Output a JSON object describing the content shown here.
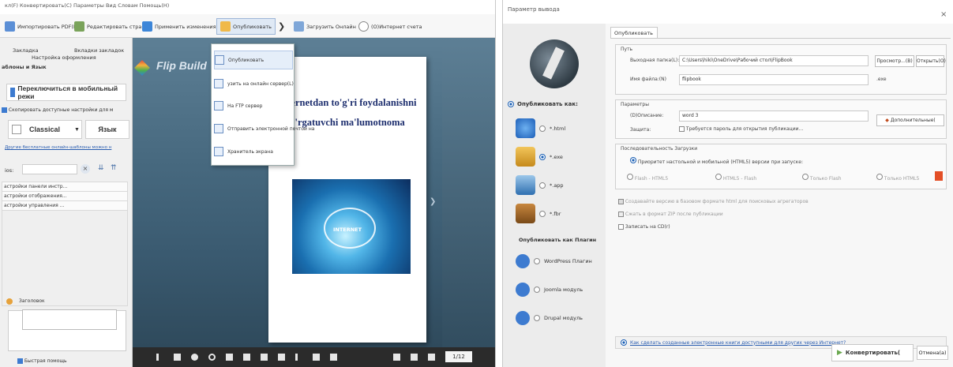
{
  "left_app": {
    "menubar": "кл(F)   Конвертировать(C)   Параметры   Вид   Словам   Помощь(H)",
    "toolbar": {
      "import_pdf": "Импортировать PDF(I)",
      "edit_pages": "Редактировать страниц",
      "apply_changes": "Применить изменения",
      "publish": "Опубликовать",
      "upload_online": "Загрузить Онлайн",
      "internet_account": "(О)Интернет счета"
    },
    "panel": {
      "tab_templates": "Закладка",
      "tab_bookmarks": "Вкладки закладок",
      "design_settings": "Настройка оформления",
      "templates_language": "аблоны и Язык",
      "mobile_switch": "Переключиться в мобильный режи",
      "copy_settings": "Скопировать доступные настройки для м",
      "theme_select": "Classical",
      "language_button": "Язык",
      "free_templates_link": "Другие бесплатные онлайн-шаблоны можно н",
      "search_label": "ios:",
      "settings_rows": [
        "астройки панели инстр...",
        "астройки отображения...",
        "астройки управления ..."
      ],
      "title_label": "Заголовок",
      "quick_help": "Быстрая помощь"
    },
    "brand": "Flip Build",
    "book": {
      "title": "Internetdan to'g'ri foydalanishni o'rgatuvchi ma'lumotnoma",
      "page_counter": "1/12",
      "image_text": "INTERNET"
    },
    "dropdown": [
      "Опубликовать",
      "узить на онлайн сервер(L)",
      "На FTP сервер",
      "Отправить электронной почтой на",
      "Хранитель экрана"
    ]
  },
  "dialog": {
    "title": "Параметр вывода",
    "close": "×",
    "tab": "Опубликовать",
    "publish_as": "Опубликовать как:",
    "formats": [
      "*.html",
      "*.exe",
      "*.app",
      "*.fbr"
    ],
    "publish_as_plugin": "Опубликовать как Плагин",
    "plugins": [
      "WordPress Плагин",
      "Joomla модуль",
      "Drupal модуль"
    ],
    "path_group": "Путь",
    "output_folder_label": "Выходная папка(L):",
    "output_folder_value": "C:\\Users\\hiki\\OneDrive\\Рабочий стол\\FlipBook",
    "browse": "Просмотр...(B)",
    "open": "Открыть(O)",
    "filename_label": "Имя файла:(N)",
    "filename_value": "flipbook",
    "ext": ".exe",
    "params_group": "Параметры",
    "description_label": "(D)Описание:",
    "description_value": "word 3",
    "protect_label": "Защита:",
    "protect_check": "Требуется пароль для открытия публикации...",
    "advanced": "Дополнительные(",
    "load_order_group": "Последовательность Загрузки",
    "priority_text": "Приоритет настольной и мобильной (HTML5) версии при запуске:",
    "load_options": [
      "Flash - HTML5",
      "HTML5 - Flash",
      "Только Flash",
      "Только HTML5"
    ],
    "create_base": "Создавайте версию в базовом формате html для поисковых агрегаторов",
    "zip": "Сжать в формат ZIP после публикации",
    "burn_cd": "Записать на CD(r)",
    "help_link": "Как сделать созданные электронные книги доступными для других через Интернет?",
    "convert": "Конвертировать(",
    "cancel": "Отмена(a)"
  }
}
